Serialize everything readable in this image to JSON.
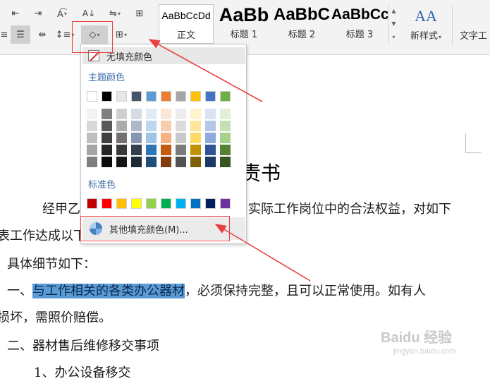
{
  "ribbon": {
    "styles": [
      {
        "sample": "AaBbCcDd",
        "name": "正文"
      },
      {
        "sample": "AaBb",
        "name": "标题 1"
      },
      {
        "sample": "AaBbC",
        "name": "标题 2"
      },
      {
        "sample": "AaBbCc",
        "name": "标题 3"
      }
    ],
    "new_style_icon": "AA",
    "new_style_label": "新样式",
    "text_tool_label": "文字工"
  },
  "fill_menu": {
    "no_fill_label": "无填充颜色",
    "theme_colors_title": "主题颜色",
    "theme_colors": [
      "#ffffff",
      "#000000",
      "#e7e6e6",
      "#44546a",
      "#5b9bd5",
      "#ed7d31",
      "#a5a5a5",
      "#ffc000",
      "#4472c4",
      "#70ad47"
    ],
    "theme_shades": [
      [
        "#f2f2f2",
        "#d8d8d8",
        "#bfbfbf",
        "#a5a5a5",
        "#7f7f7f"
      ],
      [
        "#7f7f7f",
        "#595959",
        "#3f3f3f",
        "#262626",
        "#0c0c0c"
      ],
      [
        "#d0cece",
        "#aeabab",
        "#757070",
        "#3a3838",
        "#171616"
      ],
      [
        "#d6dce4",
        "#adb9ca",
        "#8496b0",
        "#323f4f",
        "#222a35"
      ],
      [
        "#deebf6",
        "#bdd7ee",
        "#9dc3e6",
        "#2e75b5",
        "#1e4e79"
      ],
      [
        "#fbe5d5",
        "#f7cbac",
        "#f4b183",
        "#c55a11",
        "#833c0b"
      ],
      [
        "#ededed",
        "#dbdbdb",
        "#c9c9c9",
        "#7b7b7b",
        "#525252"
      ],
      [
        "#fff2cc",
        "#fee599",
        "#ffd965",
        "#bf9000",
        "#7f6000"
      ],
      [
        "#dae3f3",
        "#b4c7e7",
        "#8faadc",
        "#2f5597",
        "#1f3864"
      ],
      [
        "#e2efd9",
        "#c5e0b3",
        "#a8d08d",
        "#538135",
        "#375623"
      ]
    ],
    "standard_colors_title": "标准色",
    "standard_colors": [
      "#c00000",
      "#ff0000",
      "#ffc000",
      "#ffff00",
      "#92d050",
      "#00b050",
      "#00b0f0",
      "#0070c0",
      "#002060",
      "#7030a0"
    ],
    "more_fill_label": "其他填充颜色(M)..."
  },
  "document": {
    "title_fragment": "责书",
    "line1": "经甲乙",
    "line1_tail": "实际工作岗位中的合法权益，对如下",
    "line2": "表工作达成以下",
    "line3": "具体细节如下：",
    "line4_prefix": "一、",
    "line4_selected": "与工作相关的各类办公器材",
    "line4_suffix": "，必须保持完整，且可以正常使用。如有人",
    "line5": "损坏，需照价赔偿。",
    "line6": "二、器材售后维修移交事项",
    "line7": "1、办公设备移交"
  },
  "watermark": {
    "logo": "Baidu 经验",
    "url": "jingyan.baidu.com"
  },
  "colors": {
    "annotation_red": "#e84141",
    "selection_blue": "#5b9bd5",
    "section_title_blue": "#3a6aa8"
  }
}
